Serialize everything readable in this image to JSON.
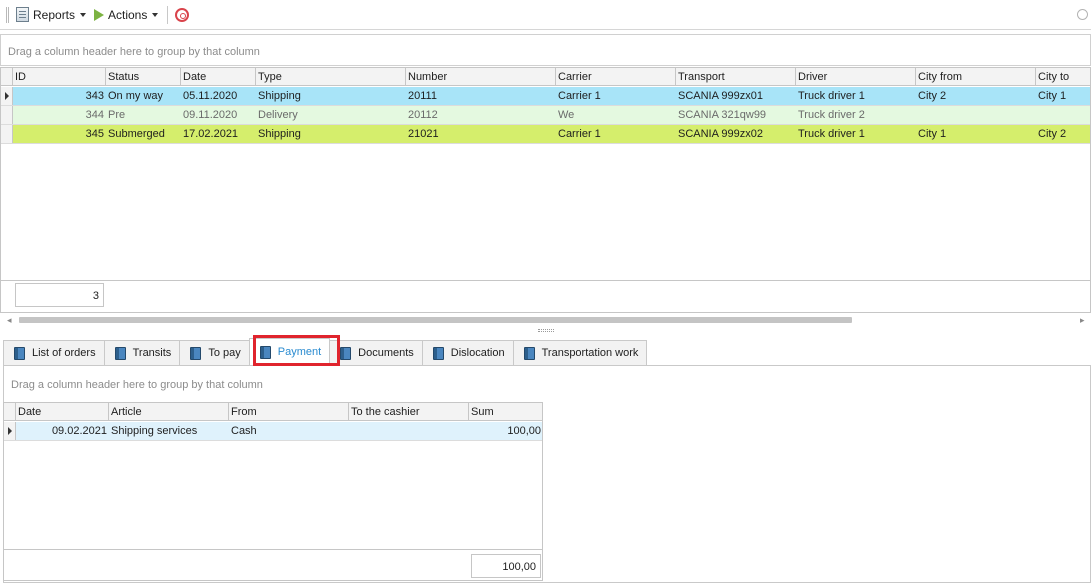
{
  "toolbar": {
    "reports_label": "Reports",
    "actions_label": "Actions",
    "icons": [
      "report-icon",
      "play-icon",
      "stop-icon"
    ]
  },
  "main_grid": {
    "group_hint": "Drag a column header here to group by that column",
    "columns": [
      "ID",
      "Status",
      "Date",
      "Type",
      "Number",
      "Carrier",
      "Transport",
      "Driver",
      "City from",
      "City to"
    ],
    "rows": [
      {
        "id": "343",
        "status": "On my way",
        "date": "05.11.2020",
        "type": "Shipping",
        "number": "20111",
        "carrier": "Carrier 1",
        "transport": "SCANIA 999zx01",
        "driver": "Truck driver 1",
        "city_from": "City 2",
        "city_to": "City 1",
        "color": "#a8e4f8",
        "selected": true
      },
      {
        "id": "344",
        "status": "Pre",
        "date": "09.11.2020",
        "type": "Delivery",
        "number": "20112",
        "carrier": "We",
        "transport": "SCANIA 321qw99",
        "driver": "Truck driver 2",
        "city_from": "",
        "city_to": "",
        "color": "#e4f9e0",
        "selected": false
      },
      {
        "id": "345",
        "status": "Submerged",
        "date": "17.02.2021",
        "type": "Shipping",
        "number": "21021",
        "carrier": "Carrier 1",
        "transport": "SCANIA 999zx02",
        "driver": "Truck driver 1",
        "city_from": "City 1",
        "city_to": "City 2",
        "color": "#d5ee6c",
        "selected": false
      }
    ],
    "count": "3"
  },
  "tabs": [
    {
      "label": "List of orders",
      "active": false
    },
    {
      "label": "Transits",
      "active": false
    },
    {
      "label": "To pay",
      "active": false
    },
    {
      "label": "Payment",
      "active": true
    },
    {
      "label": "Documents",
      "active": false
    },
    {
      "label": "Dislocation",
      "active": false
    },
    {
      "label": "Transportation work",
      "active": false
    }
  ],
  "payment_grid": {
    "group_hint": "Drag a column header here to group by that column",
    "columns": [
      "Date",
      "Article",
      "From",
      "To the cashier",
      "Sum"
    ],
    "rows": [
      {
        "date": "09.02.2021",
        "article": "Shipping services",
        "from": "Cash",
        "to_cashier": "",
        "sum": "100,00",
        "color": "#dff2fc"
      }
    ],
    "total": "100,00"
  },
  "colors": {
    "active_tab_text": "#2a8bd0",
    "highlight": "#e0242d"
  }
}
